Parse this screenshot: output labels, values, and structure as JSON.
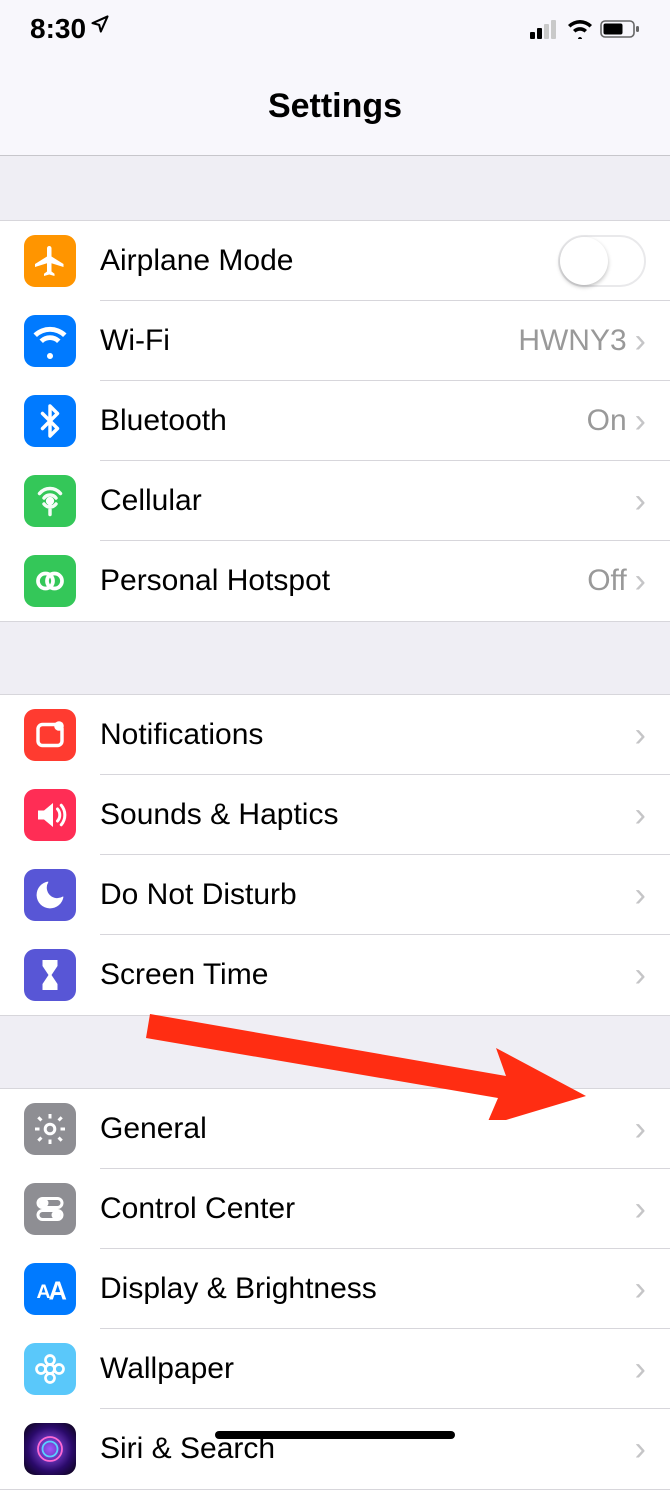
{
  "statusBar": {
    "time": "8:30"
  },
  "header": {
    "title": "Settings"
  },
  "groups": [
    {
      "rows": [
        {
          "id": "airplane-mode",
          "label": "Airplane Mode",
          "toggle": false
        },
        {
          "id": "wifi",
          "label": "Wi-Fi",
          "value": "HWNY3",
          "chevron": true
        },
        {
          "id": "bluetooth",
          "label": "Bluetooth",
          "value": "On",
          "chevron": true
        },
        {
          "id": "cellular",
          "label": "Cellular",
          "chevron": true
        },
        {
          "id": "personal-hotspot",
          "label": "Personal Hotspot",
          "value": "Off",
          "chevron": true
        }
      ]
    },
    {
      "rows": [
        {
          "id": "notifications",
          "label": "Notifications",
          "chevron": true
        },
        {
          "id": "sounds-haptics",
          "label": "Sounds & Haptics",
          "chevron": true
        },
        {
          "id": "do-not-disturb",
          "label": "Do Not Disturb",
          "chevron": true
        },
        {
          "id": "screen-time",
          "label": "Screen Time",
          "chevron": true
        }
      ]
    },
    {
      "rows": [
        {
          "id": "general",
          "label": "General",
          "chevron": true
        },
        {
          "id": "control-center",
          "label": "Control Center",
          "chevron": true
        },
        {
          "id": "display-brightness",
          "label": "Display & Brightness",
          "chevron": true
        },
        {
          "id": "wallpaper",
          "label": "Wallpaper",
          "chevron": true
        },
        {
          "id": "siri-search",
          "label": "Siri & Search",
          "chevron": true
        }
      ]
    }
  ]
}
